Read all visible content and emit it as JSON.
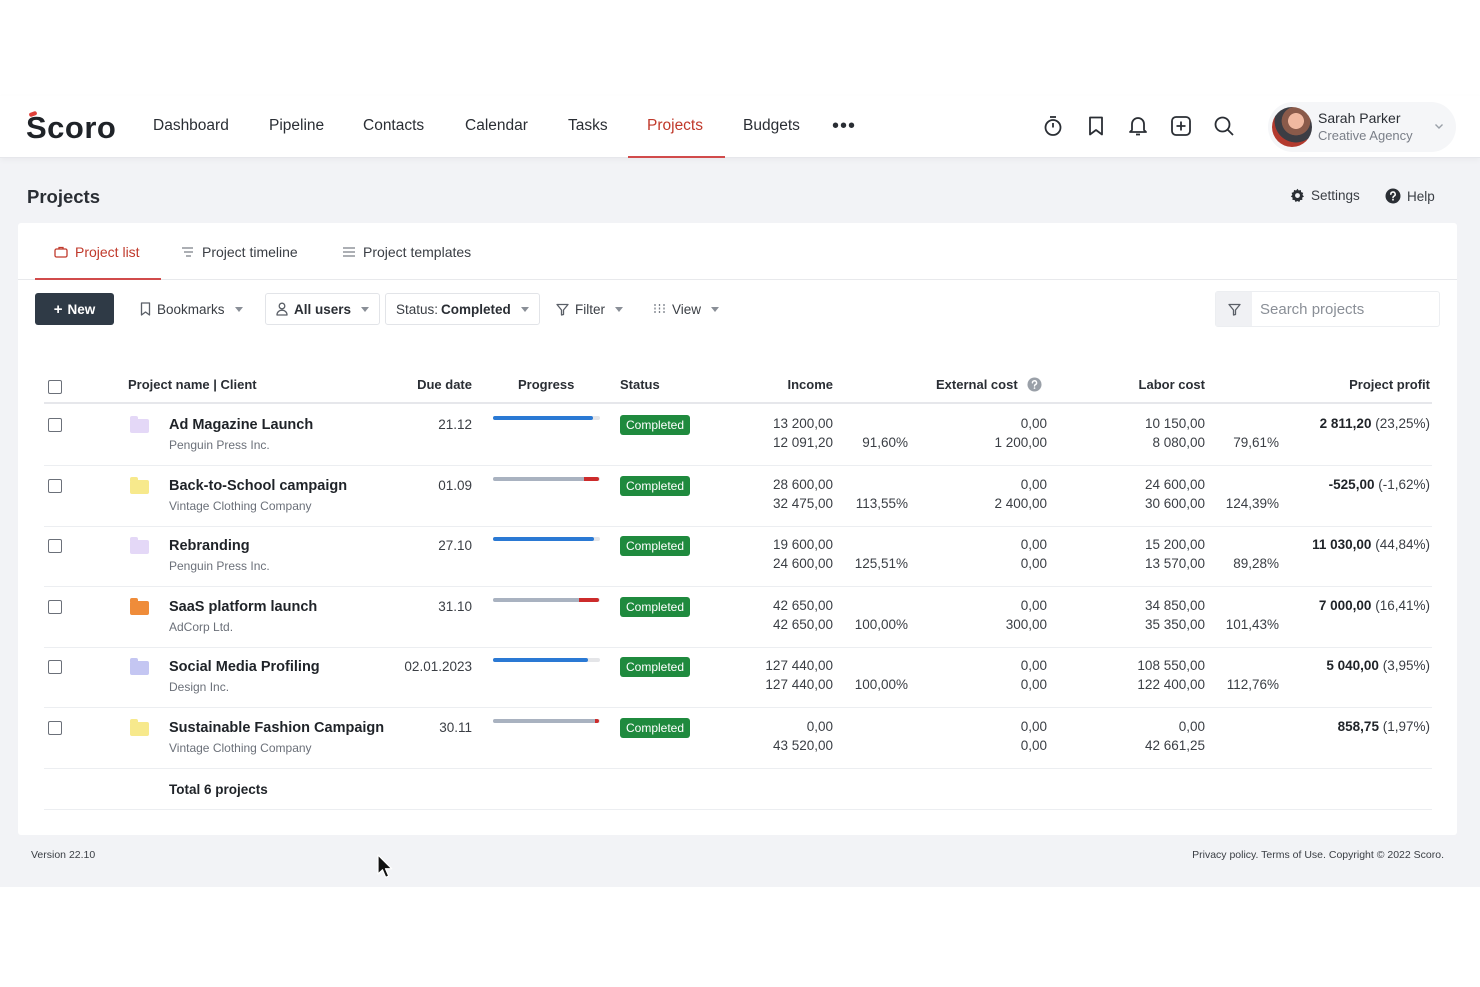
{
  "brand": {
    "logo": "Scoro"
  },
  "nav": {
    "items": [
      {
        "label": "Dashboard"
      },
      {
        "label": "Pipeline"
      },
      {
        "label": "Contacts"
      },
      {
        "label": "Calendar"
      },
      {
        "label": "Tasks"
      },
      {
        "label": "Projects",
        "active": true
      },
      {
        "label": "Budgets"
      }
    ],
    "more": "•••",
    "icons": [
      "timer-icon",
      "bookmark-icon",
      "bell-icon",
      "add-square-icon",
      "search-icon"
    ]
  },
  "user": {
    "name": "Sarah Parker",
    "org": "Creative Agency"
  },
  "page": {
    "title": "Projects",
    "settings": "Settings",
    "help": "Help"
  },
  "tabs": [
    {
      "label": "Project list",
      "active": true
    },
    {
      "label": "Project timeline"
    },
    {
      "label": "Project templates"
    }
  ],
  "toolbar": {
    "new_label": "New",
    "bookmarks": "Bookmarks",
    "users": "All users",
    "status_prefix": "Status:",
    "status_value": "Completed",
    "filter": "Filter",
    "view": "View",
    "search_placeholder": "Search projects"
  },
  "table": {
    "headers": {
      "name": "Project name | Client",
      "due": "Due date",
      "progress": "Progress",
      "status": "Status",
      "income": "Income",
      "external": "External cost",
      "labor": "Labor cost",
      "profit": "Project profit"
    },
    "rows": [
      {
        "name": "Ad Magazine Launch",
        "client": "Penguin Press Inc.",
        "folder_color": "#e4d8f7",
        "due": "21.12",
        "progress": 0.93,
        "over": 0,
        "bar_color": "#2a79d4",
        "status": "Completed",
        "income_planned": "13 200,00",
        "income_actual": "12 091,20",
        "income_pct": "91,60%",
        "ext_planned": "0,00",
        "ext_actual": "1 200,00",
        "labor_planned": "10 150,00",
        "labor_actual": "8 080,00",
        "labor_pct": "79,61%",
        "profit_value": "2 811,20",
        "profit_pct": "(23,25%)"
      },
      {
        "name": "Back-to-School campaign",
        "client": "Vintage Clothing Company",
        "folder_color": "#f7e98c",
        "due": "01.09",
        "progress": 0.85,
        "over": 0.14,
        "bar_color": "#a9b2c0",
        "status": "Completed",
        "income_planned": "28 600,00",
        "income_actual": "32 475,00",
        "income_pct": "113,55%",
        "ext_planned": "0,00",
        "ext_actual": "2 400,00",
        "labor_planned": "24 600,00",
        "labor_actual": "30 600,00",
        "labor_pct": "124,39%",
        "profit_value": "-525,00",
        "profit_pct": "(-1,62%)"
      },
      {
        "name": "Rebranding",
        "client": "Penguin Press Inc.",
        "folder_color": "#e4d8f7",
        "due": "27.10",
        "progress": 0.94,
        "over": 0,
        "bar_color": "#2a79d4",
        "status": "Completed",
        "income_planned": "19 600,00",
        "income_actual": "24 600,00",
        "income_pct": "125,51%",
        "ext_planned": "0,00",
        "ext_actual": "0,00",
        "labor_planned": "15 200,00",
        "labor_actual": "13 570,00",
        "labor_pct": "89,28%",
        "profit_value": "11 030,00",
        "profit_pct": "(44,84%)"
      },
      {
        "name": "SaaS platform launch",
        "client": "AdCorp Ltd.",
        "folder_color": "#ef8c3a",
        "due": "31.10",
        "progress": 0.8,
        "over": 0.19,
        "bar_color": "#a9b2c0",
        "status": "Completed",
        "income_planned": "42 650,00",
        "income_actual": "42 650,00",
        "income_pct": "100,00%",
        "ext_planned": "0,00",
        "ext_actual": "300,00",
        "labor_planned": "34 850,00",
        "labor_actual": "35 350,00",
        "labor_pct": "101,43%",
        "profit_value": "7 000,00",
        "profit_pct": "(16,41%)"
      },
      {
        "name": "Social Media Profiling",
        "client": "Design Inc.",
        "folder_color": "#c4c6f2",
        "due": "02.01.2023",
        "progress": 0.89,
        "over": 0,
        "bar_color": "#2a79d4",
        "status": "Completed",
        "income_planned": "127 440,00",
        "income_actual": "127 440,00",
        "income_pct": "100,00%",
        "ext_planned": "0,00",
        "ext_actual": "0,00",
        "labor_planned": "108 550,00",
        "labor_actual": "122 400,00",
        "labor_pct": "112,76%",
        "profit_value": "5 040,00",
        "profit_pct": "(3,95%)"
      },
      {
        "name": "Sustainable Fashion Campaign",
        "client": "Vintage Clothing Company",
        "folder_color": "#f7e98c",
        "due": "30.11",
        "progress": 0.95,
        "over": 0.04,
        "bar_color": "#a9b2c0",
        "status": "Completed",
        "income_planned": "0,00",
        "income_actual": "43 520,00",
        "income_pct": "",
        "ext_planned": "0,00",
        "ext_actual": "0,00",
        "labor_planned": "0,00",
        "labor_actual": "42 661,25",
        "labor_pct": "",
        "profit_value": "858,75",
        "profit_pct": "(1,97%)"
      }
    ],
    "total": "Total 6 projects"
  },
  "footer": {
    "version": "Version 22.10",
    "legal": "Privacy policy. Terms of Use. Copyright © 2022 Scoro."
  },
  "colors": {
    "accent": "#c0392b",
    "status_green": "#1f8a3e",
    "progress_blue": "#2a79d4",
    "over_red": "#cc2b2b"
  }
}
